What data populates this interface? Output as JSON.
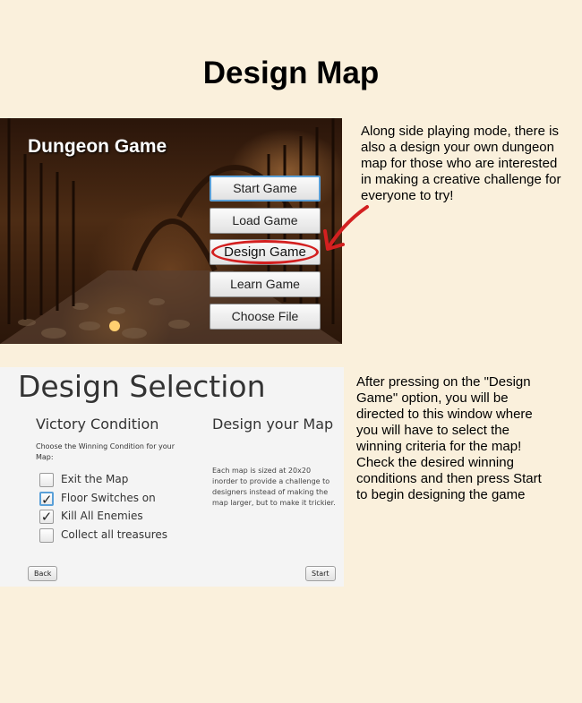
{
  "page_title": "Design Map",
  "dungeon": {
    "game_title": "Dungeon Game",
    "menu": [
      "Start Game",
      "Load Game",
      "Design Game",
      "Learn Game",
      "Choose File"
    ]
  },
  "desc1": "Along side playing mode, there is also a design your own dungeon map for those who are interested in making a creative challenge for everyone to try!",
  "selection": {
    "title": "Design Selection",
    "victory_heading": "Victory Condition",
    "victory_hint": "Choose the Winning Condition for your Map:",
    "options": [
      {
        "label": "Exit the Map",
        "checked": false
      },
      {
        "label": "Floor Switches on",
        "checked": true
      },
      {
        "label": "Kill All Enemies",
        "checked": true
      },
      {
        "label": "Collect all treasures",
        "checked": false
      }
    ],
    "design_heading": "Design your Map",
    "design_text": "Each map is sized at 20x20 inorder to provide a challenge to designers instead of making the map larger, but to make it trickier.",
    "back_label": "Back",
    "start_label": "Start"
  },
  "desc2": "After pressing on the \"Design Game\" option, you will be directed to this window where you will have to select the winning criteria for the map! Check the desired winning conditions and then press Start to begin designing the game",
  "colors": {
    "highlight_circle": "#d32020",
    "background": "#faf0dc"
  }
}
